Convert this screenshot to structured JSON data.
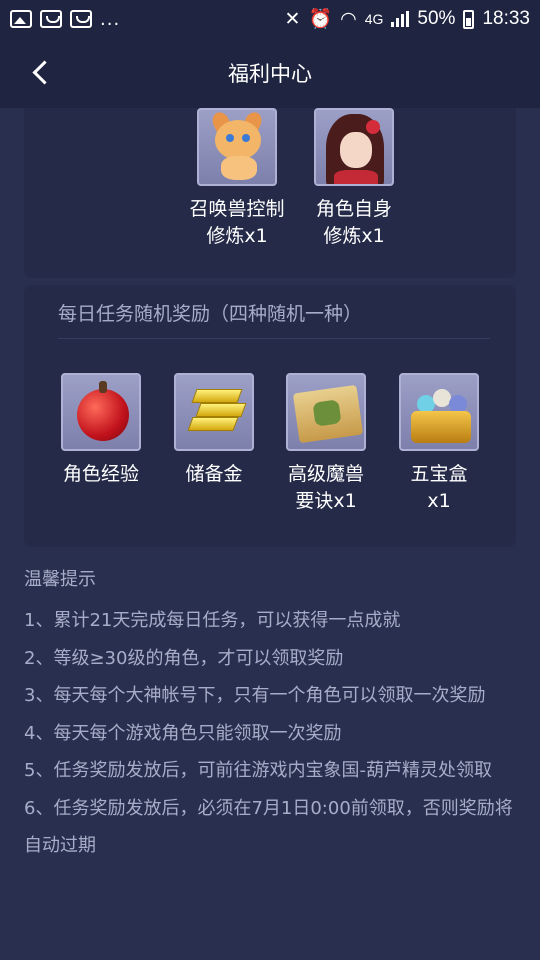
{
  "status_bar": {
    "dots": "...",
    "network": "4G",
    "battery": "50%",
    "time": "18:33"
  },
  "header": {
    "title": "福利中心"
  },
  "card1": {
    "items": [
      {
        "label": "召唤兽控制\n修炼x1",
        "icon": "pet-dog-icon"
      },
      {
        "label": "角色自身\n修炼x1",
        "icon": "girl-character-icon"
      }
    ]
  },
  "card2": {
    "title": "每日任务随机奖励（四种随机一种）",
    "items": [
      {
        "label": "角色经验",
        "icon": "apple-icon"
      },
      {
        "label": "储备金",
        "icon": "gold-bars-icon"
      },
      {
        "label": "高级魔兽\n要诀x1",
        "icon": "scroll-icon"
      },
      {
        "label": "五宝盒\nx1",
        "icon": "treasure-box-icon"
      }
    ]
  },
  "tips": {
    "title": "温馨提示",
    "items": [
      "1、累计21天完成每日任务，可以获得一点成就",
      "2、等级≥30级的角色，才可以领取奖励",
      "3、每天每个大神帐号下，只有一个角色可以领取一次奖励",
      "4、每天每个游戏角色只能领取一次奖励",
      "5、任务奖励发放后，可前往游戏内宝象国-葫芦精灵处领取",
      "6、任务奖励发放后，必须在7月1日0:00前领取，否则奖励将自动过期"
    ]
  },
  "colors": {
    "background": "#29304f",
    "header": "#1f2440",
    "card": "#242a47",
    "muted_text": "#a7adc8"
  }
}
